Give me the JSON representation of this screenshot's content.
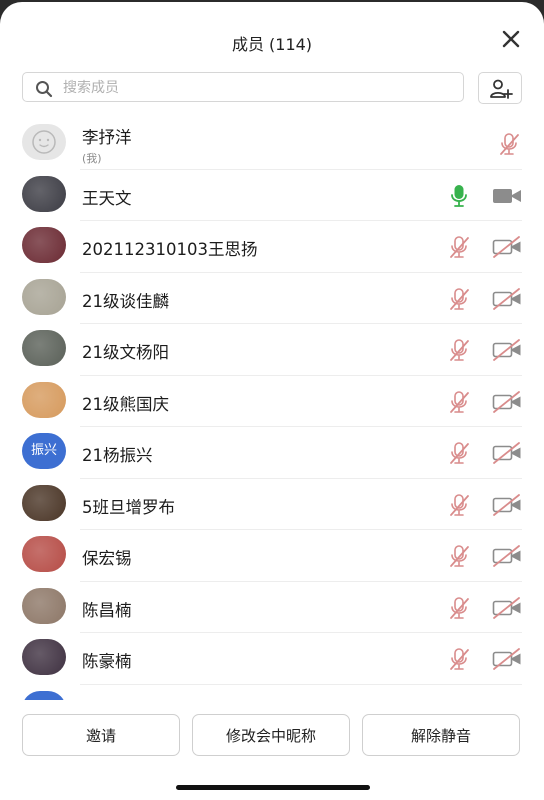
{
  "header": {
    "title": "成员 (114)"
  },
  "search": {
    "placeholder": "搜索成员"
  },
  "members": [
    {
      "name": "李抒洋",
      "sub": "(我)",
      "avatar": "default",
      "mic": "muted",
      "cam": "none"
    },
    {
      "name": "王天文",
      "avatar": "photo",
      "avatar_color": "#3c3c44",
      "mic": "active",
      "cam": "on"
    },
    {
      "name": "202112310103王思扬",
      "avatar": "photo",
      "avatar_color": "#6b2a33",
      "mic": "muted",
      "cam": "off"
    },
    {
      "name": "21级谈佳麟",
      "avatar": "photo",
      "avatar_color": "#a7a394",
      "mic": "muted",
      "cam": "off"
    },
    {
      "name": "21级文杨阳",
      "avatar": "photo",
      "avatar_color": "#5a6058",
      "mic": "muted",
      "cam": "off"
    },
    {
      "name": "21级熊国庆",
      "avatar": "photo",
      "avatar_color": "#d69a5d",
      "mic": "muted",
      "cam": "off"
    },
    {
      "name": "21杨振兴",
      "avatar": "text",
      "avatar_text": "振兴",
      "avatar_color": "#3d6fd2",
      "mic": "muted",
      "cam": "off"
    },
    {
      "name": "5班旦增罗布",
      "avatar": "photo",
      "avatar_color": "#4a3526",
      "mic": "muted",
      "cam": "off"
    },
    {
      "name": "保宏锡",
      "avatar": "photo",
      "avatar_color": "#b64c46",
      "mic": "muted",
      "cam": "off"
    },
    {
      "name": "陈昌楠",
      "avatar": "photo",
      "avatar_color": "#8d7767",
      "mic": "muted",
      "cam": "off"
    },
    {
      "name": "陈豪楠",
      "avatar": "photo",
      "avatar_color": "#3f3141",
      "mic": "muted",
      "cam": "off"
    },
    {
      "name": "",
      "avatar": "text",
      "avatar_text": "",
      "avatar_color": "#3d6fd2",
      "mic": "muted",
      "cam": "off"
    }
  ],
  "footer": {
    "invite_label": "邀请",
    "rename_label": "修改会中昵称",
    "unmute_label": "解除静音"
  },
  "colors": {
    "muted": "#d98c8c",
    "active": "#37b24d",
    "icon_gray": "#8c8c8c"
  }
}
